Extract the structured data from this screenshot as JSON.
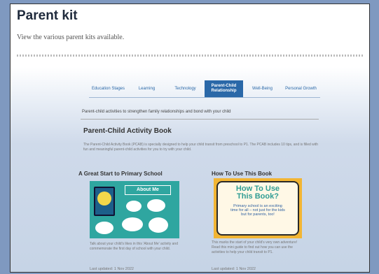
{
  "header": {
    "title": "Parent kit",
    "subtitle": "View the various parent kits available."
  },
  "tabs": [
    {
      "label": "Education Stages"
    },
    {
      "label": "Learning"
    },
    {
      "label": "Technology"
    },
    {
      "label": "Parent-Child Relationship",
      "active": true
    },
    {
      "label": "Well-Being"
    },
    {
      "label": "Personal Growth"
    }
  ],
  "tab_description": "Parent-child activities to strengthen family relationships and bond with your child",
  "section": {
    "title": "Parent-Child Activity Book",
    "description": "The Parent-Child Activity Book (PCAB) is specially designed to help your child transit from preschool to P1. The PCAB includes 10 tips, and is filled with fun and meaningful parent-child activities for you to try with your child."
  },
  "cards": [
    {
      "title": "A Great Start to Primary School",
      "thumb_heading": "About Me",
      "description": "Talk about your child's likes in this 'About Me' activity and commemorate the first day of school with your child.",
      "date": "Last updated: 1 Nov 2022"
    },
    {
      "title": "How To Use This Book",
      "thumb_heading": "How To Use\nThis Book?",
      "thumb_sub": "Primary school is an exciting\ntime for all – not just for the kids\nbut for parents, too!",
      "description": "This marks the start of your child's very own adventure! Read this mini guide to find out how you can use the activities to help your child transit to P1.",
      "date": "Last updated: 1 Nov 2022"
    }
  ],
  "colors": {
    "background": "#7f99c0",
    "accent": "#2a68a8",
    "teal": "#2fa6a0",
    "yellow": "#f2b533"
  }
}
